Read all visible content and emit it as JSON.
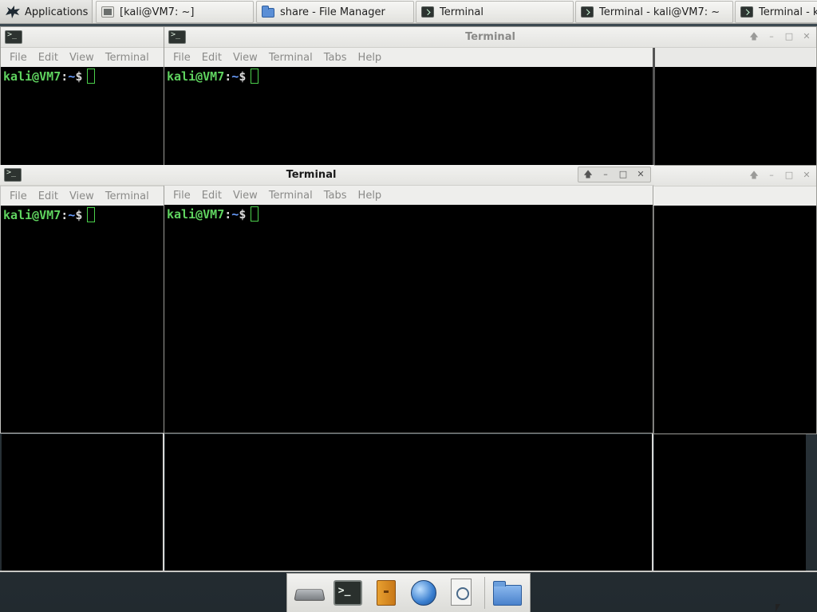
{
  "top_panel": {
    "applications_label": "Applications",
    "tasks": [
      {
        "label": "[kali@VM7: ~]",
        "icon": "terminal-icon"
      },
      {
        "label": "share - File Manager",
        "icon": "folder-icon"
      },
      {
        "label": "Terminal",
        "icon": "terminal-icon"
      },
      {
        "label": "Terminal - kali@VM7: ~",
        "icon": "terminal-icon"
      },
      {
        "label": "Terminal - k",
        "icon": "terminal-icon"
      }
    ]
  },
  "windows": {
    "top_left": {
      "menu": [
        "File",
        "Edit",
        "View",
        "Terminal"
      ]
    },
    "top_main": {
      "title": "Terminal",
      "menu": [
        "File",
        "Edit",
        "View",
        "Terminal",
        "Tabs",
        "Help"
      ]
    },
    "front_left": {
      "menu": [
        "File",
        "Edit",
        "View",
        "Terminal"
      ]
    },
    "front_main": {
      "title": "Terminal",
      "menu": [
        "File",
        "Edit",
        "View",
        "Terminal",
        "Tabs",
        "Help"
      ]
    }
  },
  "prompt": {
    "user_host": "kali@VM7",
    "sep": ":",
    "path": "~",
    "symbol": "$"
  },
  "window_controls": {
    "up": "🡅",
    "minimize": "–",
    "maximize": "□",
    "close": "✕"
  },
  "colors": {
    "prompt_user": "#5fd35f",
    "prompt_path": "#6a9fff",
    "terminal_bg": "#000000"
  }
}
